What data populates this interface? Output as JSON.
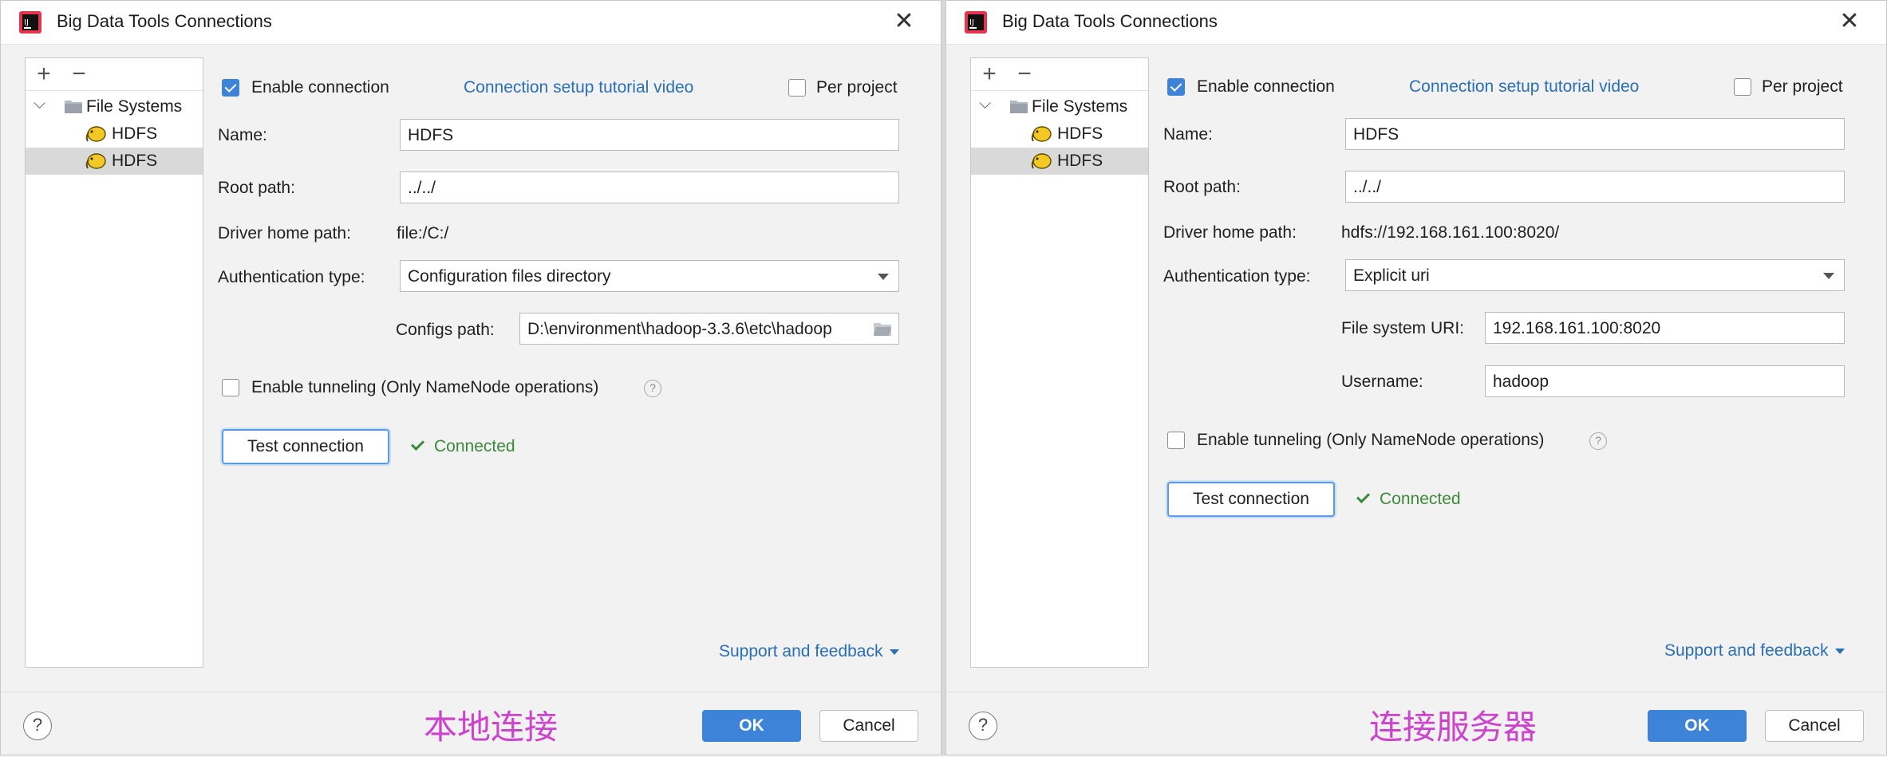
{
  "dialogs": [
    {
      "title": "Big Data Tools Connections",
      "tree": {
        "root": "File Systems",
        "items": [
          "HDFS",
          "HDFS"
        ]
      },
      "enable_connection": "Enable connection",
      "tutorial_link": "Connection setup tutorial video",
      "per_project": "Per project",
      "name_label": "Name:",
      "name_value": "HDFS",
      "root_path_label": "Root path:",
      "root_path_value": "../../",
      "driver_home_label": "Driver home path:",
      "driver_home_value": "file:/C:/",
      "auth_type_label": "Authentication type:",
      "auth_type_value": "Configuration files directory",
      "configs_path_label": "Configs path:",
      "configs_path_value": "D:\\environment\\hadoop-3.3.6\\etc\\hadoop",
      "tunneling": "Enable tunneling (Only NameNode operations)",
      "test_button": "Test connection",
      "status": "Connected",
      "support": "Support and feedback",
      "note": "本地连接",
      "ok": "OK",
      "cancel": "Cancel"
    },
    {
      "title": "Big Data Tools Connections",
      "tree": {
        "root": "File Systems",
        "items": [
          "HDFS",
          "HDFS"
        ]
      },
      "enable_connection": "Enable connection",
      "tutorial_link": "Connection setup tutorial video",
      "per_project": "Per project",
      "name_label": "Name:",
      "name_value": "HDFS",
      "root_path_label": "Root path:",
      "root_path_value": "../../",
      "driver_home_label": "Driver home path:",
      "driver_home_value": "hdfs://192.168.161.100:8020/",
      "auth_type_label": "Authentication type:",
      "auth_type_value": "Explicit uri",
      "fs_uri_label": "File system URI:",
      "fs_uri_value": "192.168.161.100:8020",
      "username_label": "Username:",
      "username_value": "hadoop",
      "tunneling": "Enable tunneling (Only NameNode operations)",
      "test_button": "Test connection",
      "status": "Connected",
      "support": "Support and feedback",
      "note": "连接服务器",
      "ok": "OK",
      "cancel": "Cancel"
    }
  ],
  "icons": {
    "tree_add": "+",
    "tree_remove": "−",
    "expand": "⌵",
    "close": "✕",
    "help": "?"
  },
  "colors": {
    "accent": "#3d83d8",
    "link": "#2a6fb6",
    "connected": "#3a8a3a",
    "note": "#cc44cc"
  }
}
